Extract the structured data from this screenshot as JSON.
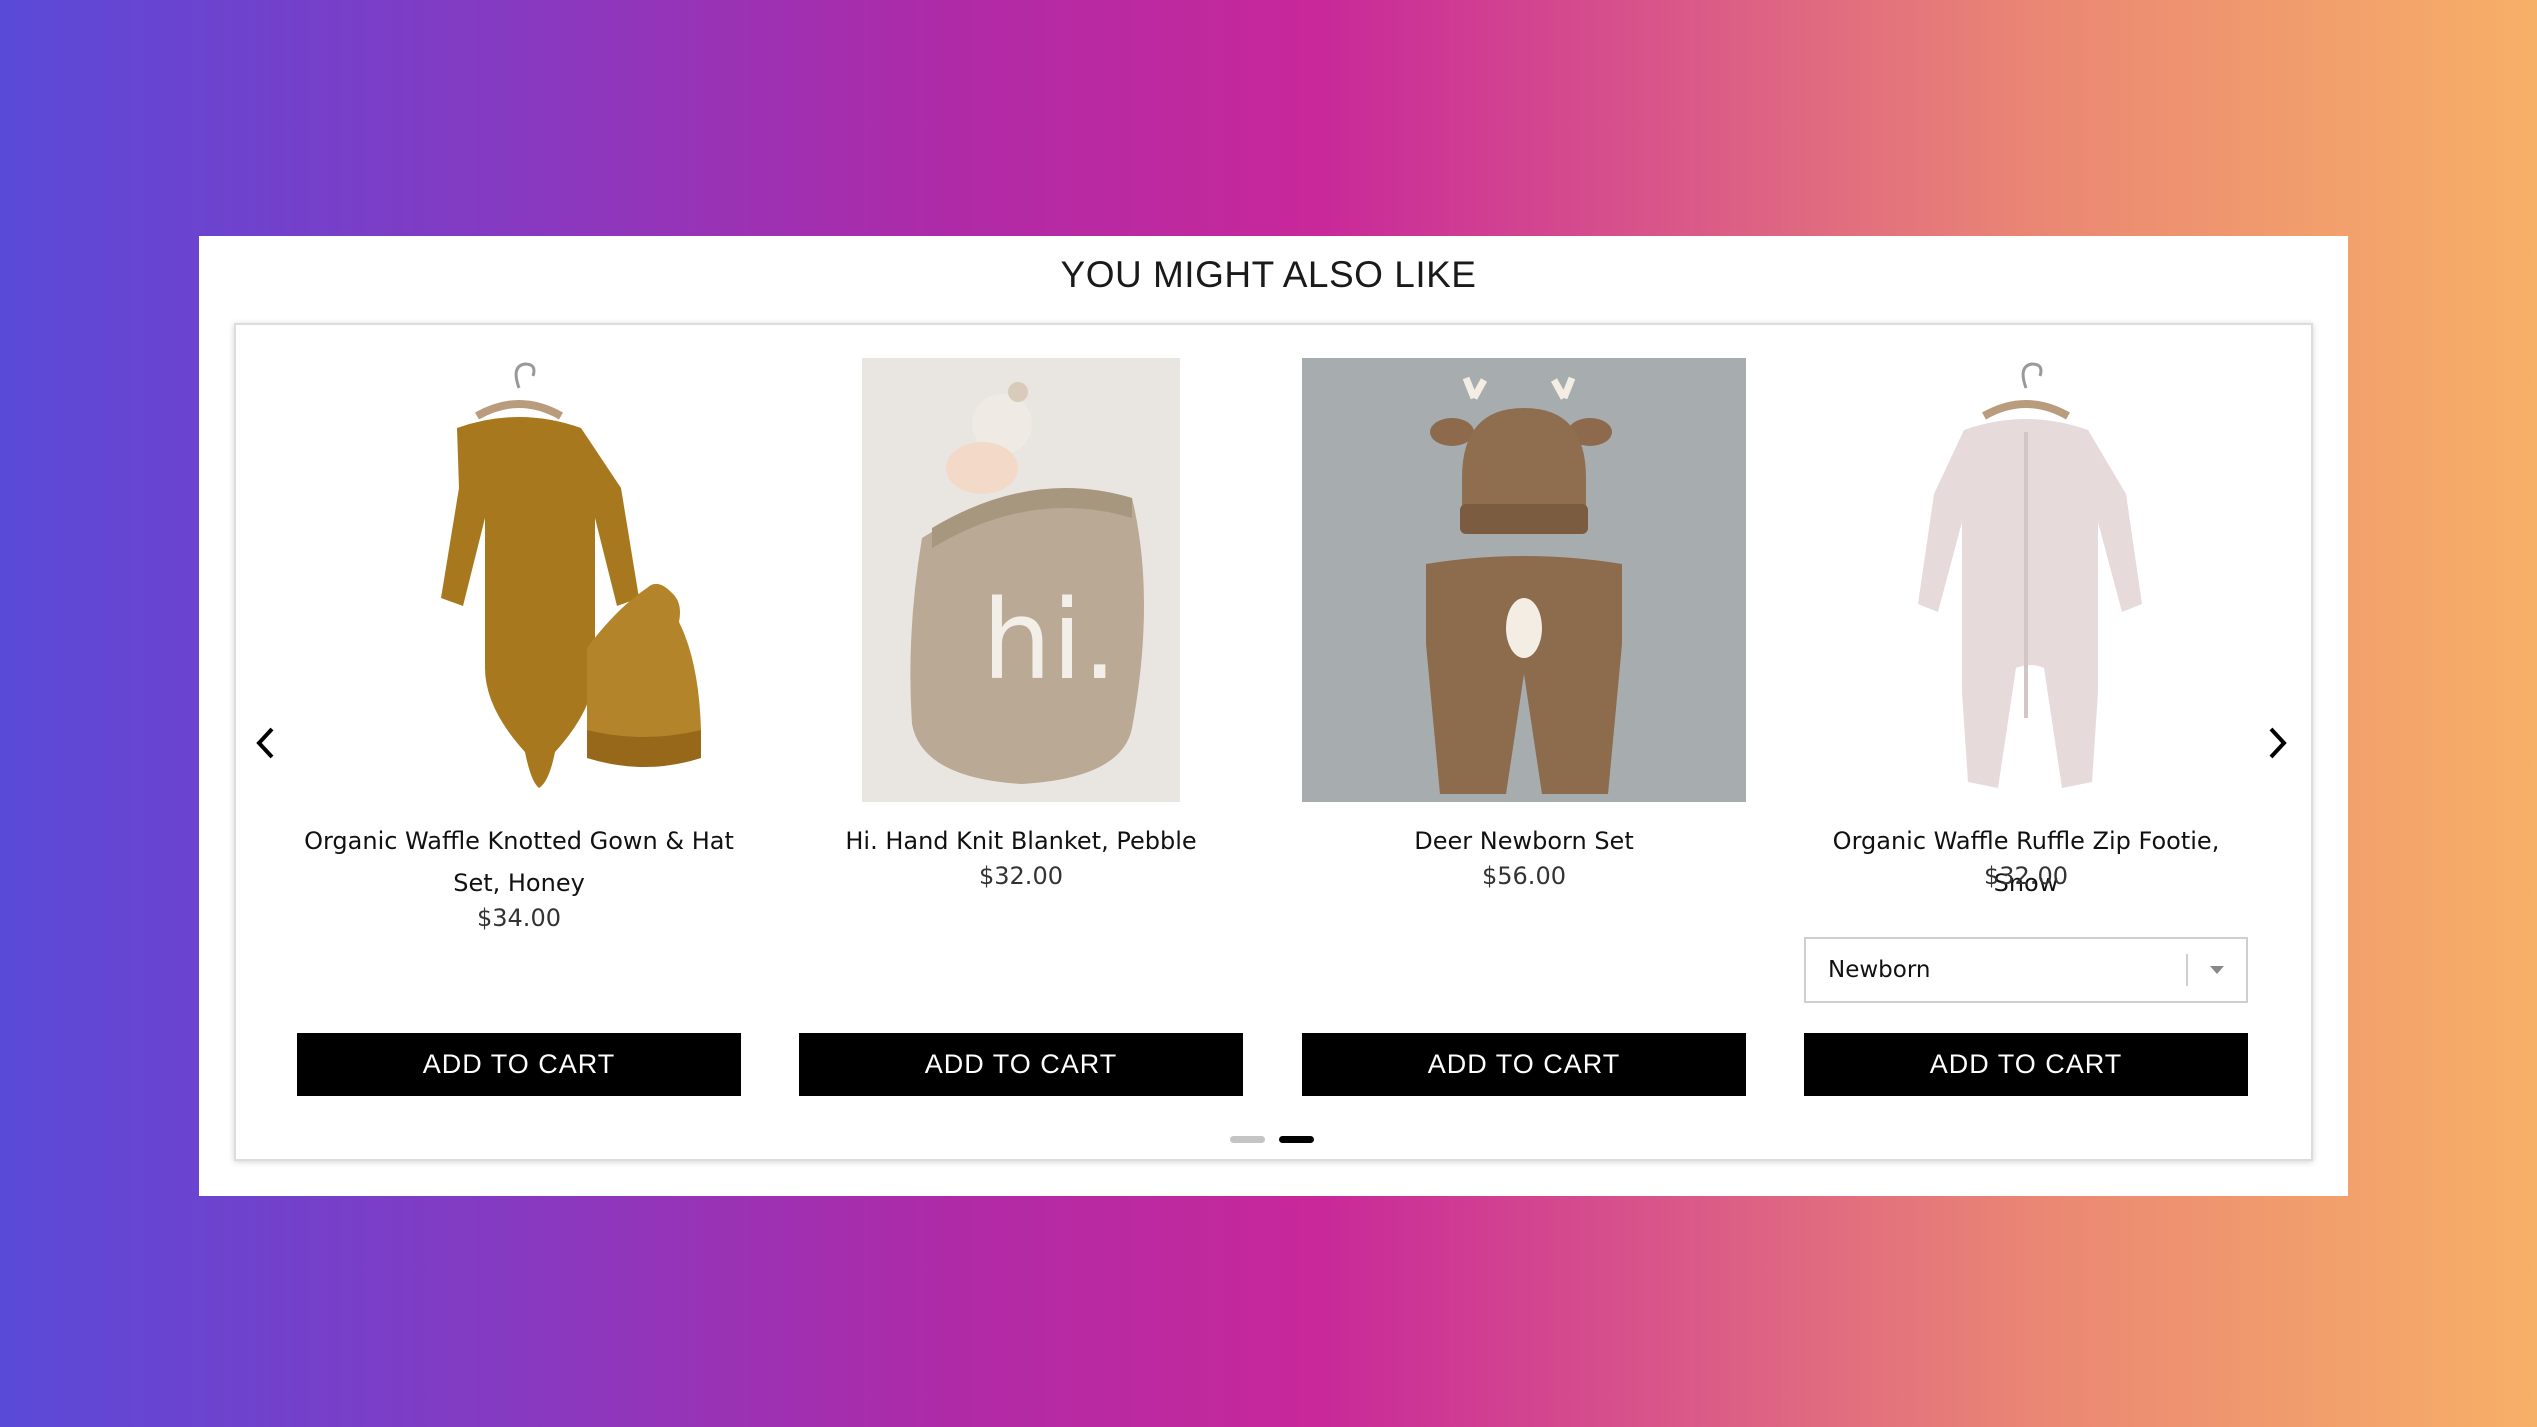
{
  "section": {
    "heading": "YOU MIGHT ALSO LIKE"
  },
  "carousel": {
    "prev_icon": "chevron-left-icon",
    "next_icon": "chevron-right-icon",
    "pages": 2,
    "active_page": 2
  },
  "products": [
    {
      "title": "Organic Waffle Knotted Gown & Hat Set, Honey",
      "price": "$34.00",
      "button": "ADD TO CART",
      "image": "honey-gown-and-hat-photo"
    },
    {
      "title": "Hi. Hand Knit Blanket, Pebble",
      "price": "$32.00",
      "button": "ADD TO CART",
      "image": "knit-blanket-photo"
    },
    {
      "title": "Deer Newborn Set",
      "price": "$56.00",
      "button": "ADD TO CART",
      "image": "deer-knit-set-photo"
    },
    {
      "title": "Organic Waffle Ruffle Zip Footie, Snow",
      "price": "$32.00",
      "button": "ADD TO CART",
      "image": "snow-footie-photo",
      "size_select": {
        "value": "Newborn"
      }
    }
  ],
  "colors": {
    "button_bg": "#000000",
    "button_text": "#ffffff",
    "dot_active": "#000000",
    "dot_inactive": "#c4c4c4"
  }
}
